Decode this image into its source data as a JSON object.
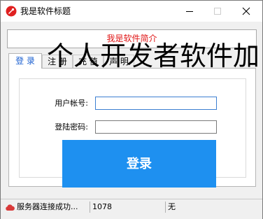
{
  "window": {
    "title": "我是软件标题",
    "colors": {
      "accent": "#1e90f0",
      "intro_text": "#e01515",
      "active_tab_text": "#1a5fd0",
      "status_icon": "#d93a3a"
    }
  },
  "intro": {
    "text": "我是软件简介"
  },
  "tabs": [
    {
      "label": "登 录",
      "active": true
    },
    {
      "label": "注 册",
      "active": false
    },
    {
      "label": "充 值",
      "active": false
    },
    {
      "label": "声 明",
      "active": false
    }
  ],
  "overlay": {
    "text": "个人开发者软件加"
  },
  "login_form": {
    "account_label": "用户帐号:",
    "account_value": "",
    "password_label": "登陆密码:",
    "password_value": "",
    "submit_label": "登录"
  },
  "statusbar": {
    "status_text": "服务器连接成功...",
    "value": "1078",
    "extra": "无",
    "icon": "cloud-icon"
  }
}
